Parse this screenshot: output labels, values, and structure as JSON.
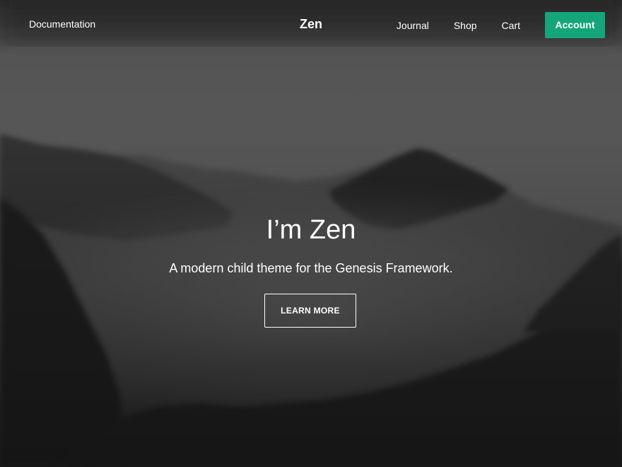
{
  "nav": {
    "left_link": "Documentation",
    "site_title": "Zen",
    "links": [
      "Journal",
      "Shop",
      "Cart"
    ],
    "account_label": "Account"
  },
  "hero": {
    "title": "I’m Zen",
    "subtitle": "A modern child theme for the Genesis Framework.",
    "button_label": "LEARN MORE",
    "background_image": "misty-mountain-forest-photo"
  },
  "colors": {
    "accent": "#14a67a",
    "text": "#ffffff"
  }
}
